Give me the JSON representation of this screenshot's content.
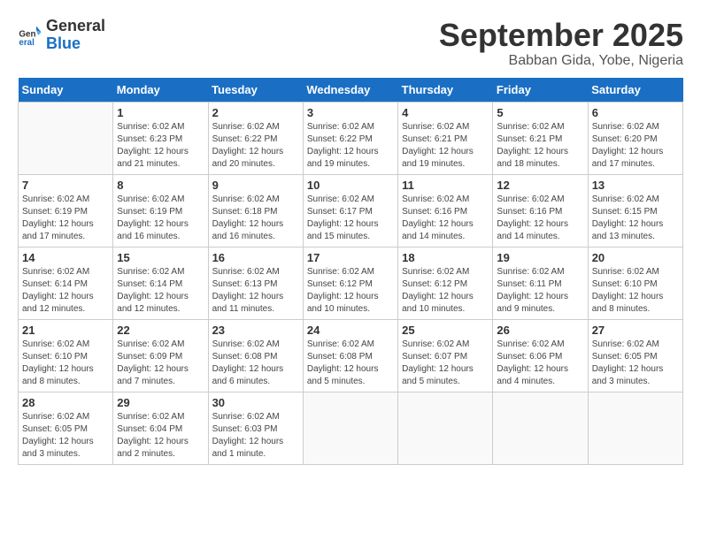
{
  "header": {
    "logo_line1": "General",
    "logo_line2": "Blue",
    "month": "September 2025",
    "location": "Babban Gida, Yobe, Nigeria"
  },
  "days_of_week": [
    "Sunday",
    "Monday",
    "Tuesday",
    "Wednesday",
    "Thursday",
    "Friday",
    "Saturday"
  ],
  "weeks": [
    [
      {
        "day": "",
        "info": ""
      },
      {
        "day": "1",
        "info": "Sunrise: 6:02 AM\nSunset: 6:23 PM\nDaylight: 12 hours\nand 21 minutes."
      },
      {
        "day": "2",
        "info": "Sunrise: 6:02 AM\nSunset: 6:22 PM\nDaylight: 12 hours\nand 20 minutes."
      },
      {
        "day": "3",
        "info": "Sunrise: 6:02 AM\nSunset: 6:22 PM\nDaylight: 12 hours\nand 19 minutes."
      },
      {
        "day": "4",
        "info": "Sunrise: 6:02 AM\nSunset: 6:21 PM\nDaylight: 12 hours\nand 19 minutes."
      },
      {
        "day": "5",
        "info": "Sunrise: 6:02 AM\nSunset: 6:21 PM\nDaylight: 12 hours\nand 18 minutes."
      },
      {
        "day": "6",
        "info": "Sunrise: 6:02 AM\nSunset: 6:20 PM\nDaylight: 12 hours\nand 17 minutes."
      }
    ],
    [
      {
        "day": "7",
        "info": "Sunrise: 6:02 AM\nSunset: 6:19 PM\nDaylight: 12 hours\nand 17 minutes."
      },
      {
        "day": "8",
        "info": "Sunrise: 6:02 AM\nSunset: 6:19 PM\nDaylight: 12 hours\nand 16 minutes."
      },
      {
        "day": "9",
        "info": "Sunrise: 6:02 AM\nSunset: 6:18 PM\nDaylight: 12 hours\nand 16 minutes."
      },
      {
        "day": "10",
        "info": "Sunrise: 6:02 AM\nSunset: 6:17 PM\nDaylight: 12 hours\nand 15 minutes."
      },
      {
        "day": "11",
        "info": "Sunrise: 6:02 AM\nSunset: 6:16 PM\nDaylight: 12 hours\nand 14 minutes."
      },
      {
        "day": "12",
        "info": "Sunrise: 6:02 AM\nSunset: 6:16 PM\nDaylight: 12 hours\nand 14 minutes."
      },
      {
        "day": "13",
        "info": "Sunrise: 6:02 AM\nSunset: 6:15 PM\nDaylight: 12 hours\nand 13 minutes."
      }
    ],
    [
      {
        "day": "14",
        "info": "Sunrise: 6:02 AM\nSunset: 6:14 PM\nDaylight: 12 hours\nand 12 minutes."
      },
      {
        "day": "15",
        "info": "Sunrise: 6:02 AM\nSunset: 6:14 PM\nDaylight: 12 hours\nand 12 minutes."
      },
      {
        "day": "16",
        "info": "Sunrise: 6:02 AM\nSunset: 6:13 PM\nDaylight: 12 hours\nand 11 minutes."
      },
      {
        "day": "17",
        "info": "Sunrise: 6:02 AM\nSunset: 6:12 PM\nDaylight: 12 hours\nand 10 minutes."
      },
      {
        "day": "18",
        "info": "Sunrise: 6:02 AM\nSunset: 6:12 PM\nDaylight: 12 hours\nand 10 minutes."
      },
      {
        "day": "19",
        "info": "Sunrise: 6:02 AM\nSunset: 6:11 PM\nDaylight: 12 hours\nand 9 minutes."
      },
      {
        "day": "20",
        "info": "Sunrise: 6:02 AM\nSunset: 6:10 PM\nDaylight: 12 hours\nand 8 minutes."
      }
    ],
    [
      {
        "day": "21",
        "info": "Sunrise: 6:02 AM\nSunset: 6:10 PM\nDaylight: 12 hours\nand 8 minutes."
      },
      {
        "day": "22",
        "info": "Sunrise: 6:02 AM\nSunset: 6:09 PM\nDaylight: 12 hours\nand 7 minutes."
      },
      {
        "day": "23",
        "info": "Sunrise: 6:02 AM\nSunset: 6:08 PM\nDaylight: 12 hours\nand 6 minutes."
      },
      {
        "day": "24",
        "info": "Sunrise: 6:02 AM\nSunset: 6:08 PM\nDaylight: 12 hours\nand 5 minutes."
      },
      {
        "day": "25",
        "info": "Sunrise: 6:02 AM\nSunset: 6:07 PM\nDaylight: 12 hours\nand 5 minutes."
      },
      {
        "day": "26",
        "info": "Sunrise: 6:02 AM\nSunset: 6:06 PM\nDaylight: 12 hours\nand 4 minutes."
      },
      {
        "day": "27",
        "info": "Sunrise: 6:02 AM\nSunset: 6:05 PM\nDaylight: 12 hours\nand 3 minutes."
      }
    ],
    [
      {
        "day": "28",
        "info": "Sunrise: 6:02 AM\nSunset: 6:05 PM\nDaylight: 12 hours\nand 3 minutes."
      },
      {
        "day": "29",
        "info": "Sunrise: 6:02 AM\nSunset: 6:04 PM\nDaylight: 12 hours\nand 2 minutes."
      },
      {
        "day": "30",
        "info": "Sunrise: 6:02 AM\nSunset: 6:03 PM\nDaylight: 12 hours\nand 1 minute."
      },
      {
        "day": "",
        "info": ""
      },
      {
        "day": "",
        "info": ""
      },
      {
        "day": "",
        "info": ""
      },
      {
        "day": "",
        "info": ""
      }
    ]
  ]
}
